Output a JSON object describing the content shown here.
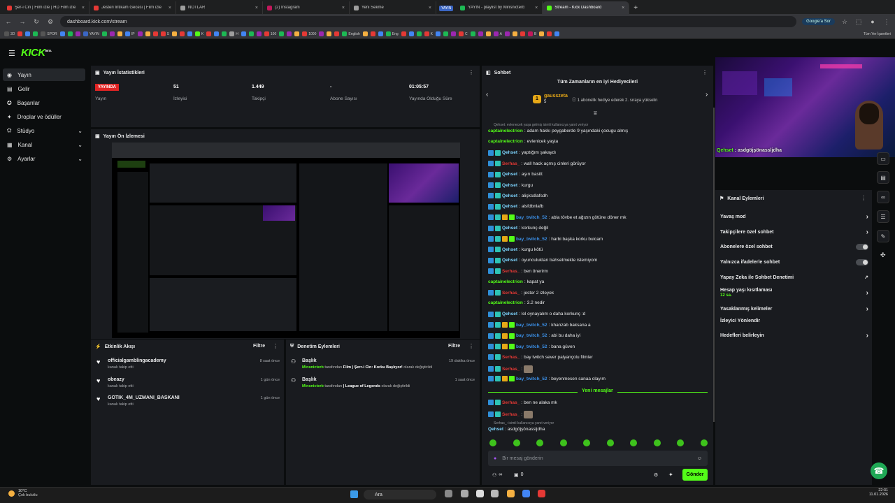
{
  "browser": {
    "tabs": [
      {
        "label": "Şer-i Cin | Film izle | HD Film izle",
        "color": "#e53935"
      },
      {
        "label": "Jesteri İntikam Gecesi | Film izle",
        "color": "#e53935"
      },
      {
        "label": "NOTLAR",
        "color": "#9e9e9e"
      },
      {
        "label": "(2) Instagram",
        "color": "#c2185b"
      },
      {
        "label": "Yeni Sekme",
        "color": "#9e9e9e"
      },
      {
        "label": "YAYIN - playlist by Minsnicterb",
        "color": "#1db954"
      },
      {
        "label": "Stream - Kick Dashboard",
        "color": "#53fc18"
      }
    ],
    "yayin_group": "YAYIN",
    "url": "dashboard.kick.com/stream",
    "google_sor": "Google'a Sor",
    "bookmarks": [
      "3D",
      "SPOR",
      "YAYIN",
      "IP",
      "S",
      "K",
      "H",
      "100",
      "1000",
      "English",
      "Eng",
      "K",
      "C",
      "A",
      "B"
    ],
    "all_bookmarks": "Tüm Yer İşaretleri"
  },
  "app": {
    "logo": "KICK",
    "logo_beta": "BETA"
  },
  "sidebar": [
    {
      "label": "Yayın",
      "icon": "broadcast-icon"
    },
    {
      "label": "Gelir",
      "icon": "wallet-icon"
    },
    {
      "label": "Başarılar",
      "icon": "trophy-icon"
    },
    {
      "label": "Droplar ve ödüller",
      "icon": "gift-icon"
    },
    {
      "label": "Stüdyo",
      "icon": "studio-icon"
    },
    {
      "label": "Kanal",
      "icon": "grid-icon"
    },
    {
      "label": "Ayarlar",
      "icon": "gear-icon"
    }
  ],
  "stats": {
    "title": "Yayın İstatistikleri",
    "live_badge": "YAYINDA",
    "items": [
      {
        "value": "",
        "label": "Yayın"
      },
      {
        "value": "51",
        "label": "İzleyici"
      },
      {
        "value": "1.449",
        "label": "Takipçi"
      },
      {
        "value": "-",
        "label": "Abone Sayısı"
      },
      {
        "value": "01:05:57",
        "label": "Yayında Olduğu Süre"
      }
    ]
  },
  "preview": {
    "title": "Yayın Ön İzlemesi"
  },
  "activity": {
    "title": "Etkinlik Akışı",
    "filter": "Filtre",
    "items": [
      {
        "name": "officialgamblingacademy",
        "sub": "kanalı takip etti",
        "time": "8 saat önce"
      },
      {
        "name": "obeazy",
        "sub": "kanalı takip etti",
        "time": "1 gün önce"
      },
      {
        "name": "GOTIK_4M_UZMANI_BASKANI",
        "sub": "kanalı takip etti",
        "time": "1 gün önce"
      }
    ]
  },
  "moderation": {
    "title": "Denetim Eylemleri",
    "filter": "Filtre",
    "items": [
      {
        "head": "Başlık",
        "user": "Minsnicterb",
        "mid": "tarafından",
        "value": "Film | Şerr-i Cin: Korku Başlıyor!",
        "tail": "olarak değiştirildi",
        "time": "19 dakika önce"
      },
      {
        "head": "Başlık",
        "user": "Minsnicterb",
        "mid": "tarafından",
        "value": "| League of Legends",
        "tail": "olarak değiştirildi",
        "time": "1 saat önce"
      }
    ]
  },
  "chat": {
    "title": "Sohbet",
    "top_gifters": "Tüm Zamanların en iyi Hediyecileri",
    "gifter_name": "gausszeta",
    "gifter_count": "5",
    "gifter_note": "1 abonelik hediye ederek 2. sıraya yükselin",
    "reply_note": "Qehset: evlenecek yaşa gelmiş isimli kullanıcıya yanıt veriyor",
    "messages": [
      {
        "user": "captainelectrion",
        "color": "green",
        "text": "adam hakkı peygaberde 9 yaşındaki çocugu almış",
        "badges": 0
      },
      {
        "user": "captainelectrion",
        "color": "green",
        "text": "evlenicek yaşta",
        "badges": 0
      },
      {
        "user": "Qehset",
        "color": "teal",
        "text": "yaptığım şakaydı",
        "badges": 2
      },
      {
        "user": "Serhas_",
        "color": "red",
        "text": "wall hack açmış cinleri görüyor",
        "badges": 2
      },
      {
        "user": "Qehset",
        "color": "teal",
        "text": "aşırı basitt",
        "badges": 2
      },
      {
        "user": "Qehset",
        "color": "teal",
        "text": "kurgu",
        "badges": 2
      },
      {
        "user": "Qehset",
        "color": "teal",
        "text": "alişksdlafsdh",
        "badges": 2
      },
      {
        "user": "Qehset",
        "color": "teal",
        "text": "alsfdbnlafb",
        "badges": 2
      },
      {
        "user": "bay_twitch_52",
        "color": "blue",
        "text": "abla tövbe et ağızın götüne döner mk",
        "badges": 4
      },
      {
        "user": "Qehset",
        "color": "teal",
        "text": "korkunç değil",
        "badges": 2
      },
      {
        "user": "bay_twitch_52",
        "color": "blue",
        "text": "harbi başka korku bulcam",
        "badges": 4
      },
      {
        "user": "Qehset",
        "color": "teal",
        "text": "kurgu kötü",
        "badges": 2
      },
      {
        "user": "Qehset",
        "color": "teal",
        "text": "oyunculuktan bahsetmekte istemiyom",
        "badges": 2
      },
      {
        "user": "Serhas_",
        "color": "red",
        "text": "ben önerirm",
        "badges": 2
      },
      {
        "user": "captainelectrion",
        "color": "green",
        "text": "kapat ya",
        "badges": 0
      },
      {
        "user": "Serhas_",
        "color": "red",
        "text": "jester 2 izleyek",
        "badges": 2
      },
      {
        "user": "captainelectrion",
        "color": "green",
        "text": "3.2 nedir",
        "badges": 0
      },
      {
        "user": "Qehset",
        "color": "teal",
        "text": "lol oynayalım o daha korkunç :d",
        "badges": 2
      },
      {
        "user": "bay_twitch_52",
        "color": "blue",
        "text": "khanzab baksana a",
        "badges": 4
      },
      {
        "user": "bay_twitch_52",
        "color": "blue",
        "text": "abi bu daha iyi",
        "badges": 4
      },
      {
        "user": "bay_twitch_52",
        "color": "blue",
        "text": "bana güven",
        "badges": 4
      },
      {
        "user": "Serhas_",
        "color": "red",
        "text": "bay twitch sever palyançolu filmler",
        "badges": 2
      },
      {
        "user": "Serhas_",
        "color": "red",
        "text": "",
        "badges": 2
      },
      {
        "user": "bay_twitch_52",
        "color": "blue",
        "text": "beyenmesen sanaa olayım",
        "badges": 4
      }
    ],
    "new_messages": "Yeni mesajlar",
    "new": [
      {
        "user": "Serhas_",
        "color": "red",
        "text": "ben ne alaka mk",
        "badges": 2
      },
      {
        "user": "Serhas_",
        "color": "red",
        "text": "",
        "badges": 2
      }
    ],
    "reply_note2": "Serhas_: isimli kullanıcıya yanıt veriyor",
    "last": {
      "user": "Qehset",
      "color": "teal",
      "text": "asdgöjşönassljdha"
    },
    "placeholder": "Bir mesaj gönderin",
    "count_link": "∞",
    "count_box": "0",
    "send": "Gönder"
  },
  "camera": {
    "user": "Qehset",
    "text": "asdgöjşönassljdha"
  },
  "channel_actions": {
    "title": "Kanal Eylemleri",
    "items": [
      {
        "label": "Yavaş mod",
        "type": "chevron"
      },
      {
        "label": "Takipçilere özel sohbet",
        "type": "chevron"
      },
      {
        "label": "Abonelere özel sohbet",
        "type": "toggle"
      },
      {
        "label": "Yalnızca ifadelerle sohbet",
        "type": "toggle"
      },
      {
        "label": "Yapay Zeka ile Sohbet Denetimi",
        "type": "external"
      },
      {
        "label": "Hesap yaşı kısıtlaması",
        "type": "chevron",
        "sub": "12 sa."
      },
      {
        "label": "Yasaklanmış kelimeler",
        "type": "chevron"
      },
      {
        "label": "İzleyici Yönlendir",
        "type": "none"
      },
      {
        "label": "Hedefleri belirleyin",
        "type": "chevron"
      }
    ]
  },
  "taskbar": {
    "weather_temp": "10°C",
    "weather_text": "Çok bulutlu",
    "search": "Ara",
    "time": "22:31",
    "date": "11.01.2026"
  }
}
